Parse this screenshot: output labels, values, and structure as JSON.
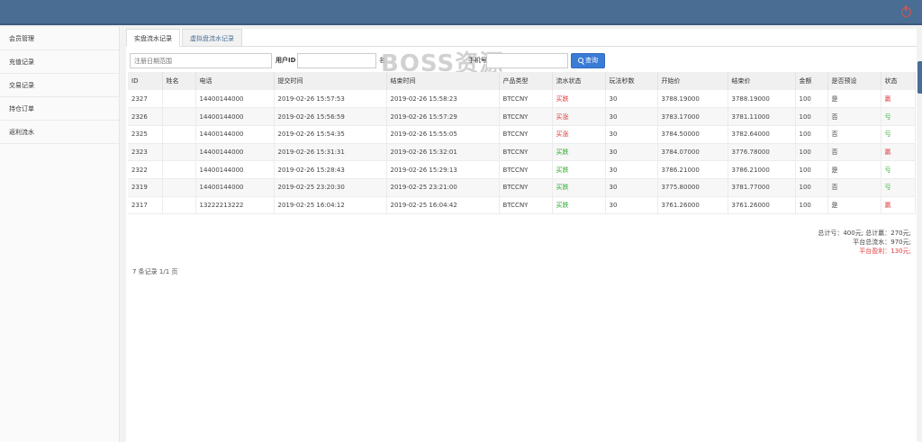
{
  "sidebar": {
    "items": [
      {
        "label": "会员管理"
      },
      {
        "label": "充值记录"
      },
      {
        "label": "交易记录"
      },
      {
        "label": "持仓订单"
      },
      {
        "label": "返利流水"
      }
    ]
  },
  "tabs": [
    {
      "label": "实盘流水记录",
      "active": true
    },
    {
      "label": "虚拟盘流水记录",
      "active": false
    }
  ],
  "filter": {
    "date_placeholder": "注册日期范围",
    "user_id_label": "用户ID",
    "user_id_value": "",
    "name_label": "名",
    "phone_label": "手机号",
    "phone_value": "",
    "search_label": "查询"
  },
  "watermark": "BOSS资源",
  "table": {
    "headers": [
      "ID",
      "姓名",
      "电话",
      "提交时间",
      "结束时间",
      "产品类型",
      "流水状态",
      "玩法秒数",
      "开始价",
      "结束价",
      "金额",
      "是否预设",
      "状态"
    ],
    "rows": [
      {
        "id": "2327",
        "name": "",
        "phone": "14400144000",
        "submit": "2019-02-26 15:57:53",
        "end": "2019-02-26 15:58:23",
        "product": "BTCCNY",
        "flow": "买跌",
        "flow_type": "down",
        "seconds": "30",
        "open": "3788.19000",
        "close": "3788.19000",
        "amount": "100",
        "preset": "是",
        "status": "赢",
        "status_type": "down"
      },
      {
        "id": "2326",
        "name": "",
        "phone": "14400144000",
        "submit": "2019-02-26 15:56:59",
        "end": "2019-02-26 15:57:29",
        "product": "BTCCNY",
        "flow": "买涨",
        "flow_type": "down",
        "seconds": "30",
        "open": "3783.17000",
        "close": "3781.11000",
        "amount": "100",
        "preset": "否",
        "status": "亏",
        "status_type": "up"
      },
      {
        "id": "2325",
        "name": "",
        "phone": "14400144000",
        "submit": "2019-02-26 15:54:35",
        "end": "2019-02-26 15:55:05",
        "product": "BTCCNY",
        "flow": "买涨",
        "flow_type": "down",
        "seconds": "30",
        "open": "3784.50000",
        "close": "3782.64000",
        "amount": "100",
        "preset": "否",
        "status": "亏",
        "status_type": "up"
      },
      {
        "id": "2323",
        "name": "",
        "phone": "14400144000",
        "submit": "2019-02-26 15:31:31",
        "end": "2019-02-26 15:32:01",
        "product": "BTCCNY",
        "flow": "买跌",
        "flow_type": "up",
        "seconds": "30",
        "open": "3784.07000",
        "close": "3776.78000",
        "amount": "100",
        "preset": "否",
        "status": "赢",
        "status_type": "down"
      },
      {
        "id": "2322",
        "name": "",
        "phone": "14400144000",
        "submit": "2019-02-26 15:28:43",
        "end": "2019-02-26 15:29:13",
        "product": "BTCCNY",
        "flow": "买跌",
        "flow_type": "up",
        "seconds": "30",
        "open": "3786.21000",
        "close": "3786.21000",
        "amount": "100",
        "preset": "是",
        "status": "亏",
        "status_type": "up"
      },
      {
        "id": "2319",
        "name": "",
        "phone": "14400144000",
        "submit": "2019-02-25 23:20:30",
        "end": "2019-02-25 23:21:00",
        "product": "BTCCNY",
        "flow": "买跌",
        "flow_type": "up",
        "seconds": "30",
        "open": "3775.80000",
        "close": "3781.77000",
        "amount": "100",
        "preset": "否",
        "status": "亏",
        "status_type": "up"
      },
      {
        "id": "2317",
        "name": "",
        "phone": "13222213222",
        "submit": "2019-02-25 16:04:12",
        "end": "2019-02-25 16:04:42",
        "product": "BTCCNY",
        "flow": "买跌",
        "flow_type": "up",
        "seconds": "30",
        "open": "3761.26000",
        "close": "3761.26000",
        "amount": "100",
        "preset": "是",
        "status": "赢",
        "status_type": "down"
      }
    ]
  },
  "summary": {
    "line1": "总计亏：400元; 总计赢：270元;",
    "line2": "平台总流水：970元;",
    "line3": "平台盈利：130元;"
  },
  "pager": "7 条记录 1/1 页",
  "colors": {
    "topbar": "#4a6d94",
    "up": "#2eaa2e",
    "down": "#e03b3b",
    "button": "#3a7bd5"
  }
}
